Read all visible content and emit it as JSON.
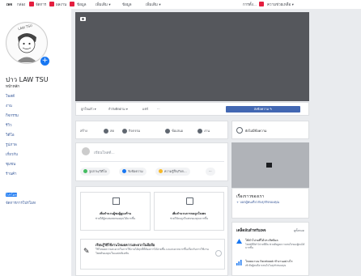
{
  "topbar": {
    "items": [
      "เพจ",
      "กล่อง",
      "จัดการ",
      "ผลงาน",
      "ข้อมูล",
      "เพิ่มเติม ▾"
    ],
    "right_items": [
      "การตั้ง...",
      "ความช่วยเหลือ ▾"
    ]
  },
  "profile": {
    "name": "ปาว LAW TSU",
    "avatar_tag": "LAW TSU"
  },
  "sidebar": {
    "items": [
      "หน้าหลัก",
      "โพสต์",
      "งาน",
      "กิจกรรม",
      "รีวิว",
      "วิดีโอ",
      "รูปภาพ",
      "เกี่ยวกับ",
      "ชุมชน",
      "ร้านค้า"
    ],
    "promote_label": "โปรโมท",
    "manage_label": "จัดการการโปรโมท"
  },
  "actionbar": {
    "like_label": "ถูกใจแล้ว ▾",
    "follow_label": "กำลังติดตาม ▾",
    "share_label": "แชร์",
    "more_label": "···",
    "cta_label": "ส่งข้อความ ✎"
  },
  "tabs": {
    "create_label": "สร้าง",
    "items": [
      "สด",
      "กิจกรรม",
      "ข้อเสนอ",
      "งาน"
    ]
  },
  "composer": {
    "placeholder": "เขียนโพสต์...",
    "pills": [
      "รูปภาพ/วิดีโอ",
      "รับข้อความ",
      "ความรู้สึก/กิจก...",
      "···"
    ]
  },
  "suggestions": [
    {
      "title": "เพิ่มจำนวนผู้ชมผู้ดูแลร้าน",
      "sub": "ช่วยให้ผู้คนพบเพจของคุณได้มากขึ้น"
    },
    {
      "title": "เพิ่มจำนวนการกดถูกใจเพจ",
      "sub": "ช่วยให้คนถูกใจเพจของคุณมากขึ้น"
    }
  ],
  "tip": {
    "title": "เรียนรู้วิธีใช้งานโหมดความสะดวกในมือถือ",
    "body": "ใช้โหมดความสะดวกในการใช้งานได้ทุกที่ที่ต้องการได้ง่ายขึ้น และสะดวกมากขึ้นเกี่ยวกับการใช้งานโพสต์ของคุณในแอปพลิเคชัน"
  },
  "right_column": {
    "message_label": "ยังไม่มีข้อความ",
    "about_title": "เรื่องราวของเรา",
    "about_link": "+ บอกผู้คนเกี่ยวกับธุรกิจของคุณ",
    "aware_title": "เคล็ดลับสำหรับเพจ",
    "aware_more": "ดูทั้งหมด",
    "aware_items": [
      {
        "title": "ใช้คำโปรยที่ได้ประสิทธิผล",
        "body": "โพสต์ที่มีคำโปรยที่ดีจะช่วยดึงดูดความสนใจของผู้คนได้มากขึ้น"
      },
      {
        "title": "โฆษณาบน Facebook ทำงานอย่างไร",
        "body": "เข้าถึงผู้คนที่อาจสนใจในธุรกิจของคุณ"
      }
    ]
  },
  "colors": {
    "accent": "#4267b2",
    "cover": "#55575c",
    "background": "#e9ebee",
    "alert": "#e41e3f"
  }
}
